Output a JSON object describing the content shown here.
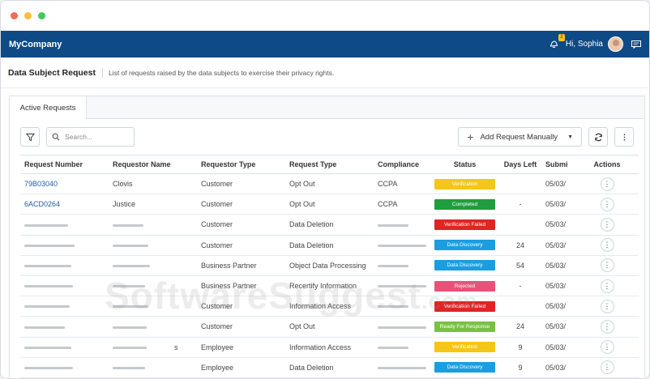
{
  "window": {
    "controls": [
      "close",
      "minimize",
      "maximize"
    ]
  },
  "appbar": {
    "brand": "MyCompany",
    "notification_count": "2",
    "greeting": "Hi, Sophia",
    "icons": [
      "bell-icon",
      "avatar",
      "message-icon"
    ]
  },
  "page": {
    "title": "Data Subject Request",
    "description": "List of requests raised by the data subjects to exercise their privacy rights."
  },
  "tabs": [
    {
      "label": "Active Requests",
      "active": true
    }
  ],
  "toolbar": {
    "search_placeholder": "Search...",
    "add_label": "Add Request Manually"
  },
  "table": {
    "columns": [
      "Request Number",
      "Requestor Name",
      "Requestor Type",
      "Request Type",
      "Compliance",
      "Status",
      "Days Left",
      "Submi",
      "Actions"
    ],
    "rows": [
      {
        "number": "79B03040",
        "name": "Clovis",
        "rtype": "Customer",
        "reqtype": "Opt Out",
        "compliance": "CCPA",
        "status": "Verification",
        "status_color": "#f5c518",
        "days": "",
        "submitted": "05/03/"
      },
      {
        "number": "6ACD0264",
        "name": "Justice",
        "rtype": "Customer",
        "reqtype": "Opt Out",
        "compliance": "CCPA",
        "status": "Completed",
        "status_color": "#1e9e3e",
        "days": "-",
        "submitted": "05/03/"
      },
      {
        "number": "",
        "name": "",
        "rtype": "Customer",
        "reqtype": "Data Deletion",
        "compliance": "",
        "status": "Verification Failed",
        "status_color": "#e02424",
        "days": "",
        "submitted": "05/03/"
      },
      {
        "number": "",
        "name": "",
        "rtype": "Customer",
        "reqtype": "Data Deletion",
        "compliance": "",
        "status": "Data Discovery",
        "status_color": "#1a9ee0",
        "days": "24",
        "submitted": "05/03/"
      },
      {
        "number": "",
        "name": "",
        "rtype": "Business Partner",
        "reqtype": "Object Data Processing",
        "compliance": "",
        "status": "Data Discovery",
        "status_color": "#1a9ee0",
        "days": "54",
        "submitted": "05/03/"
      },
      {
        "number": "",
        "name": "",
        "rtype": "Business Partner",
        "reqtype": "Recertify Information",
        "compliance": "",
        "status": "Rejected",
        "status_color": "#e8527a",
        "days": "-",
        "submitted": "05/03/"
      },
      {
        "number": "",
        "name": "",
        "rtype": "Customer",
        "reqtype": "Information Access",
        "compliance": "",
        "status": "Verification Failed",
        "status_color": "#e02424",
        "days": "",
        "submitted": "05/03/"
      },
      {
        "number": "",
        "name": "",
        "rtype": "Customer",
        "reqtype": "Opt Out",
        "compliance": "",
        "status": "Ready For Response",
        "status_color": "#7ac142",
        "days": "24",
        "submitted": "05/03/"
      },
      {
        "number": "",
        "name": "s",
        "rtype": "Employee",
        "reqtype": "Information Access",
        "compliance": "",
        "status": "Verification",
        "status_color": "#f5c518",
        "days": "9",
        "submitted": "05/03/"
      },
      {
        "number": "",
        "name": "",
        "rtype": "Employee",
        "reqtype": "Data Deletion",
        "compliance": "",
        "status": "Data Discovery",
        "status_color": "#1a9ee0",
        "days": "9",
        "submitted": "05/03/"
      }
    ]
  },
  "watermark": {
    "main": "SoftwareSuggest",
    "suffix": ".com"
  }
}
